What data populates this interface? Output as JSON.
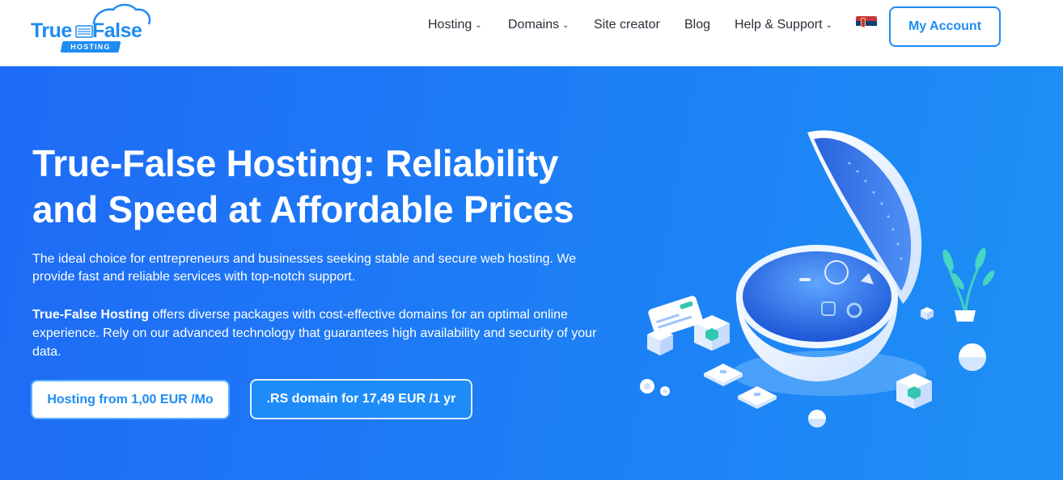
{
  "brand": {
    "logo_word_1": "True",
    "logo_word_2": "False",
    "logo_badge": "HOSTING"
  },
  "nav": {
    "items": [
      {
        "label": "Hosting",
        "has_dropdown": true
      },
      {
        "label": "Domains",
        "has_dropdown": true
      },
      {
        "label": "Site creator",
        "has_dropdown": false
      },
      {
        "label": "Blog",
        "has_dropdown": false
      },
      {
        "label": "Help & Support",
        "has_dropdown": true
      }
    ],
    "language_flag": "serbia-flag-icon",
    "account_button": "My Account"
  },
  "hero": {
    "title": "True-False Hosting: Reliability and Speed at Affordable Prices",
    "paragraph_1": "The ideal choice for entrepreneurs and businesses seeking stable and secure web hosting. We provide fast and reliable services with top-notch support.",
    "paragraph_2_bold": "True-False Hosting",
    "paragraph_2_rest": " offers diverse packages with cost-effective domains for an optimal online experience. Rely on our advanced technology that guarantees high availability and security of your data.",
    "button_hosting": "Hosting from 1,00 EUR /Mo",
    "button_domain": ".RS domain for 17,49 EUR /1 yr"
  },
  "colors": {
    "brand_blue": "#1e8cf2",
    "hero_gradient_start": "#1e6bf5",
    "hero_gradient_end": "#1e90f5"
  }
}
